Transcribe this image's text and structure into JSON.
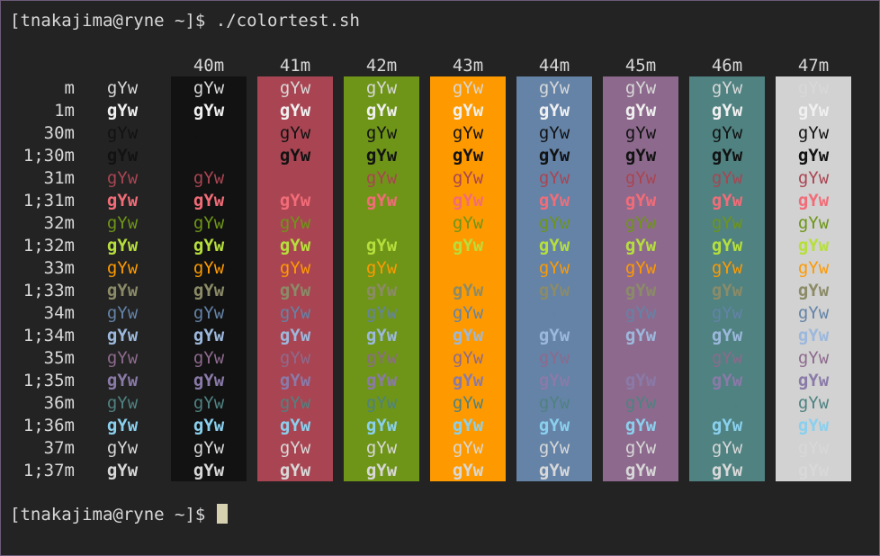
{
  "terminal": {
    "command_prompt": "[tnakajima@ryne ~]$ ",
    "command": "./colortest.sh",
    "final_prompt": "[tnakajima@ryne ~]$ "
  },
  "colortest": {
    "sample_text": "gYw",
    "columns": [
      {
        "label": "",
        "bg": null
      },
      {
        "label": "40m",
        "bg": "#121212"
      },
      {
        "label": "41m",
        "bg": "#a94552"
      },
      {
        "label": "42m",
        "bg": "#6e9518"
      },
      {
        "label": "43m",
        "bg": "#fe9a00"
      },
      {
        "label": "44m",
        "bg": "#6483a7"
      },
      {
        "label": "45m",
        "bg": "#8d6a8d"
      },
      {
        "label": "46m",
        "bg": "#4f8281"
      },
      {
        "label": "47m",
        "bg": "#d2d2d2"
      }
    ],
    "rows": [
      {
        "label": "m",
        "fg": "#d8d8d8",
        "bold": false
      },
      {
        "label": "1m",
        "fg": "#f0f0f0",
        "bold": true
      },
      {
        "label": "30m",
        "fg": "#121212",
        "bold": false
      },
      {
        "label": "1;30m",
        "fg": "#121212",
        "bold": true
      },
      {
        "label": "31m",
        "fg": "#a94552",
        "bold": false
      },
      {
        "label": "1;31m",
        "fg": "#f26c78",
        "bold": true
      },
      {
        "label": "32m",
        "fg": "#6e9518",
        "bold": false
      },
      {
        "label": "1;32m",
        "fg": "#b6df3c",
        "bold": true
      },
      {
        "label": "33m",
        "fg": "#fe9a00",
        "bold": false
      },
      {
        "label": "1;33m",
        "fg": "#8b8b68",
        "bold": true
      },
      {
        "label": "34m",
        "fg": "#6483a7",
        "bold": false
      },
      {
        "label": "1;34m",
        "fg": "#9cb8dc",
        "bold": true
      },
      {
        "label": "35m",
        "fg": "#8d6a8d",
        "bold": false
      },
      {
        "label": "1;35m",
        "fg": "#8a7aa8",
        "bold": true
      },
      {
        "label": "36m",
        "fg": "#4f8281",
        "bold": false
      },
      {
        "label": "1;36m",
        "fg": "#8ad0ee",
        "bold": true
      },
      {
        "label": "37m",
        "fg": "#d8d8d8",
        "bold": false
      },
      {
        "label": "1;37m",
        "fg": "#d8d8d8",
        "bold": true
      }
    ]
  }
}
